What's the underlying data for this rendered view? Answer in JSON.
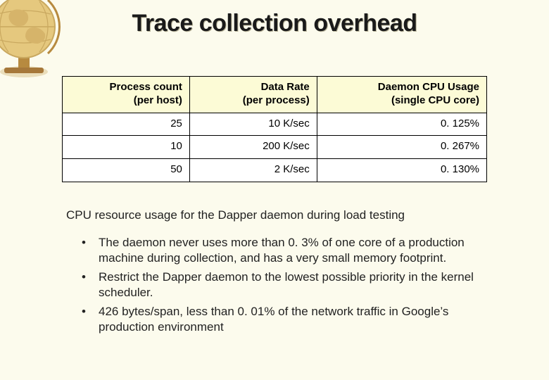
{
  "title": "Trace collection overhead",
  "chart_data": {
    "type": "table",
    "headers": [
      "Process count\n(per host)",
      "Data Rate\n(per process)",
      "Daemon CPU Usage\n(single CPU core)"
    ],
    "rows": [
      [
        "25",
        "10 K/sec",
        "0. 125%"
      ],
      [
        "10",
        "200 K/sec",
        "0. 267%"
      ],
      [
        "50",
        "2 K/sec",
        "0. 130%"
      ]
    ]
  },
  "table": {
    "h0a": "Process count",
    "h0b": "(per host)",
    "h1a": "Data Rate",
    "h1b": "(per process)",
    "h2a": "Daemon CPU Usage",
    "h2b": "(single CPU core)",
    "r0c0": "25",
    "r0c1": "10 K/sec",
    "r0c2": "0. 125%",
    "r1c0": "10",
    "r1c1": "200 K/sec",
    "r1c2": "0. 267%",
    "r2c0": "50",
    "r2c1": "2 K/sec",
    "r2c2": "0. 130%"
  },
  "caption": "CPU resource usage for the Dapper daemon during load testing",
  "bullets": {
    "b0": "The daemon never uses more than 0. 3% of one core of a production machine during collection, and has a very small memory footprint.",
    "b1": "Restrict the Dapper daemon to the lowest possible priority in the kernel scheduler.",
    "b2": "426 bytes/span, less than 0. 01% of the network traffic in Google’s production environment"
  },
  "decor": {
    "globe_icon": "globe-icon"
  }
}
